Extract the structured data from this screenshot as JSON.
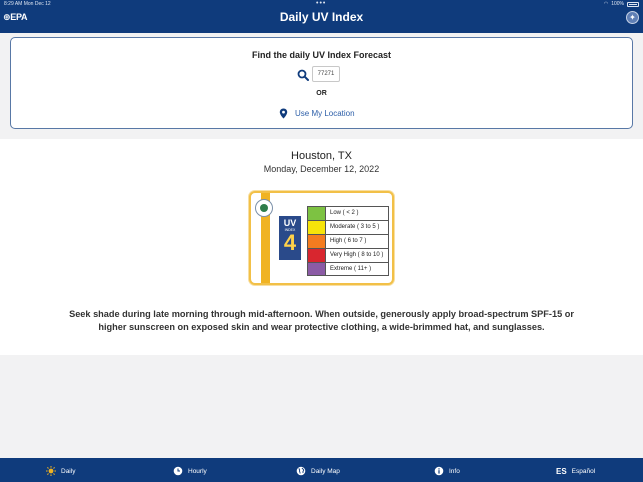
{
  "status_bar": {
    "time_date": "8:29 AM   Mon Dec 12",
    "battery": "100%"
  },
  "header": {
    "logo": "⊕EPA",
    "title": "Daily UV Index",
    "language_icon": "globe-icon"
  },
  "search": {
    "title": "Find the daily UV Index Forecast",
    "zip_value": "77271",
    "or_label": "OR",
    "use_location_label": "Use My Location"
  },
  "forecast": {
    "city": "Houston, TX",
    "date": "Monday, December 12, 2022",
    "uv_word": "UV",
    "uv_index_label": "INDEX",
    "uv_value": "4",
    "scale": [
      {
        "label": "Low    ( < 2 )",
        "color": "#7dc242"
      },
      {
        "label": "Moderate  ( 3 to 5 )",
        "color": "#f7e40a"
      },
      {
        "label": "High  ( 6 to 7 )",
        "color": "#f47c20"
      },
      {
        "label": "Very High  ( 8 to 10 )",
        "color": "#d8262f"
      },
      {
        "label": "Extreme  ( 11+ )",
        "color": "#8b5ba5"
      }
    ],
    "advice": "Seek shade during late morning through mid-afternoon. When outside, generously apply broad-spectrum SPF-15 or higher sunscreen on exposed skin  and wear protective clothing, a wide-brimmed hat, and sunglasses."
  },
  "nav": {
    "daily": "Daily",
    "hourly": "Hourly",
    "daily_map": "Daily Map",
    "info": "Info",
    "espanol_icon": "ES",
    "espanol": "Español"
  },
  "colors": {
    "brand_navy": "#0f3b7c",
    "link_blue": "#2c5ea8",
    "uv_gold": "#f0b323"
  }
}
